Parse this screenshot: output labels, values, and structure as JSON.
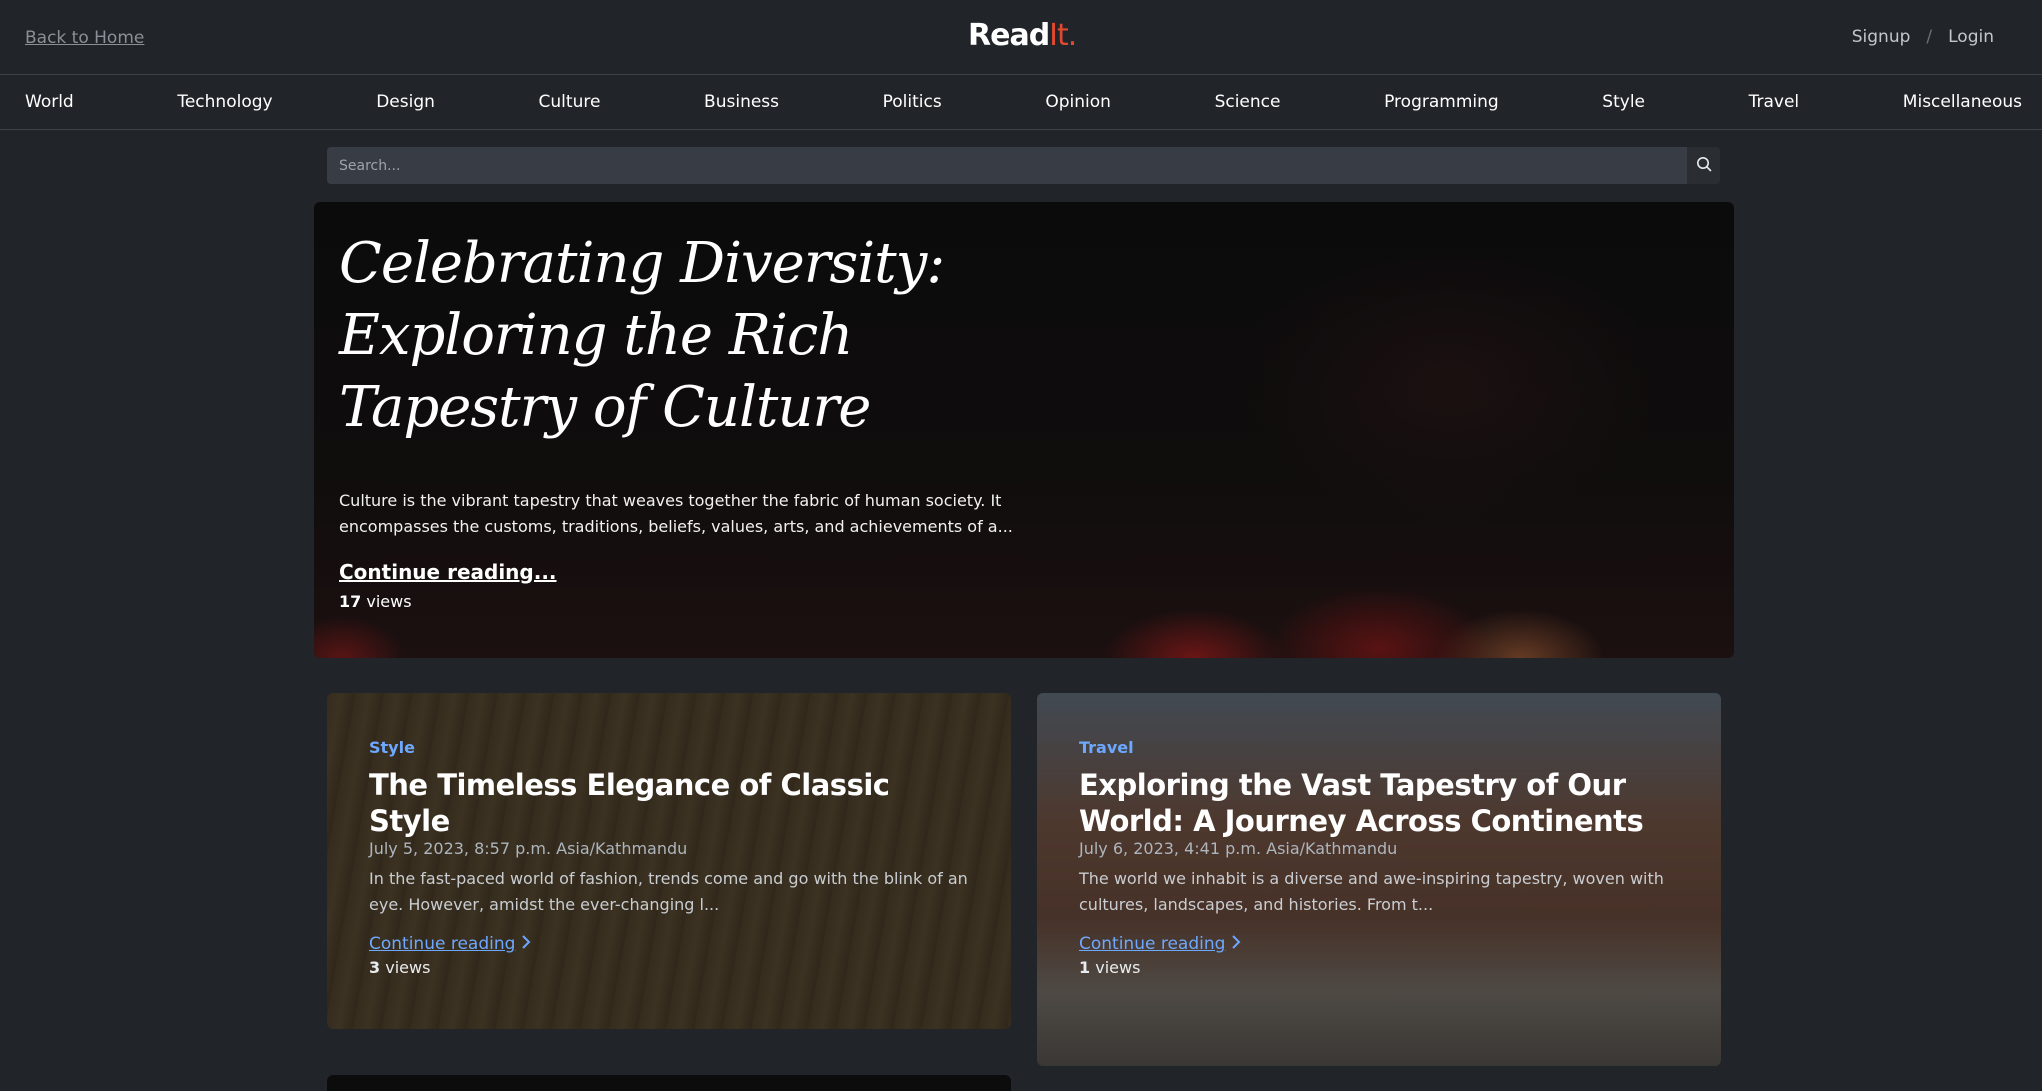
{
  "header": {
    "back_home": "Back to Home",
    "logo_main": "Read",
    "logo_accent": "It.",
    "signup": "Signup",
    "separator": "/",
    "login": "Login"
  },
  "categories": [
    "World",
    "Technology",
    "Design",
    "Culture",
    "Business",
    "Politics",
    "Opinion",
    "Science",
    "Programming",
    "Style",
    "Travel",
    "Miscellaneous"
  ],
  "search": {
    "placeholder": "Search...",
    "icon": "search-icon"
  },
  "hero": {
    "title": "Celebrating Diversity: Exploring the Rich Tapestry of Culture",
    "excerpt": "Culture is the vibrant tapestry that weaves together the fabric of human society. It encompasses the customs, traditions, beliefs, values, arts, and achievements of a...",
    "continue": "Continue reading...",
    "views_count": "17",
    "views_label": "views"
  },
  "cards": [
    {
      "category": "Style",
      "title": "The Timeless Elegance of Classic Style",
      "date": "July 5, 2023, 8:57 p.m. Asia/Kathmandu",
      "excerpt": "In the fast-paced world of fashion, trends come and go with the blink of an eye. However, amidst the ever-changing l...",
      "continue": "Continue reading",
      "views_count": "3",
      "views_label": "views"
    },
    {
      "category": "Travel",
      "title": "Exploring the Vast Tapestry of Our World: A Journey Across Continents",
      "date": "July 6, 2023, 4:41 p.m. Asia/Kathmandu",
      "excerpt": "The world we inhabit is a diverse and awe-inspiring tapestry, woven with cultures, landscapes, and histories. From t...",
      "continue": "Continue reading",
      "views_count": "1",
      "views_label": "views"
    }
  ],
  "colors": {
    "background": "#212529",
    "accent_link": "#6ea8fe",
    "logo_accent": "#e0482f"
  }
}
